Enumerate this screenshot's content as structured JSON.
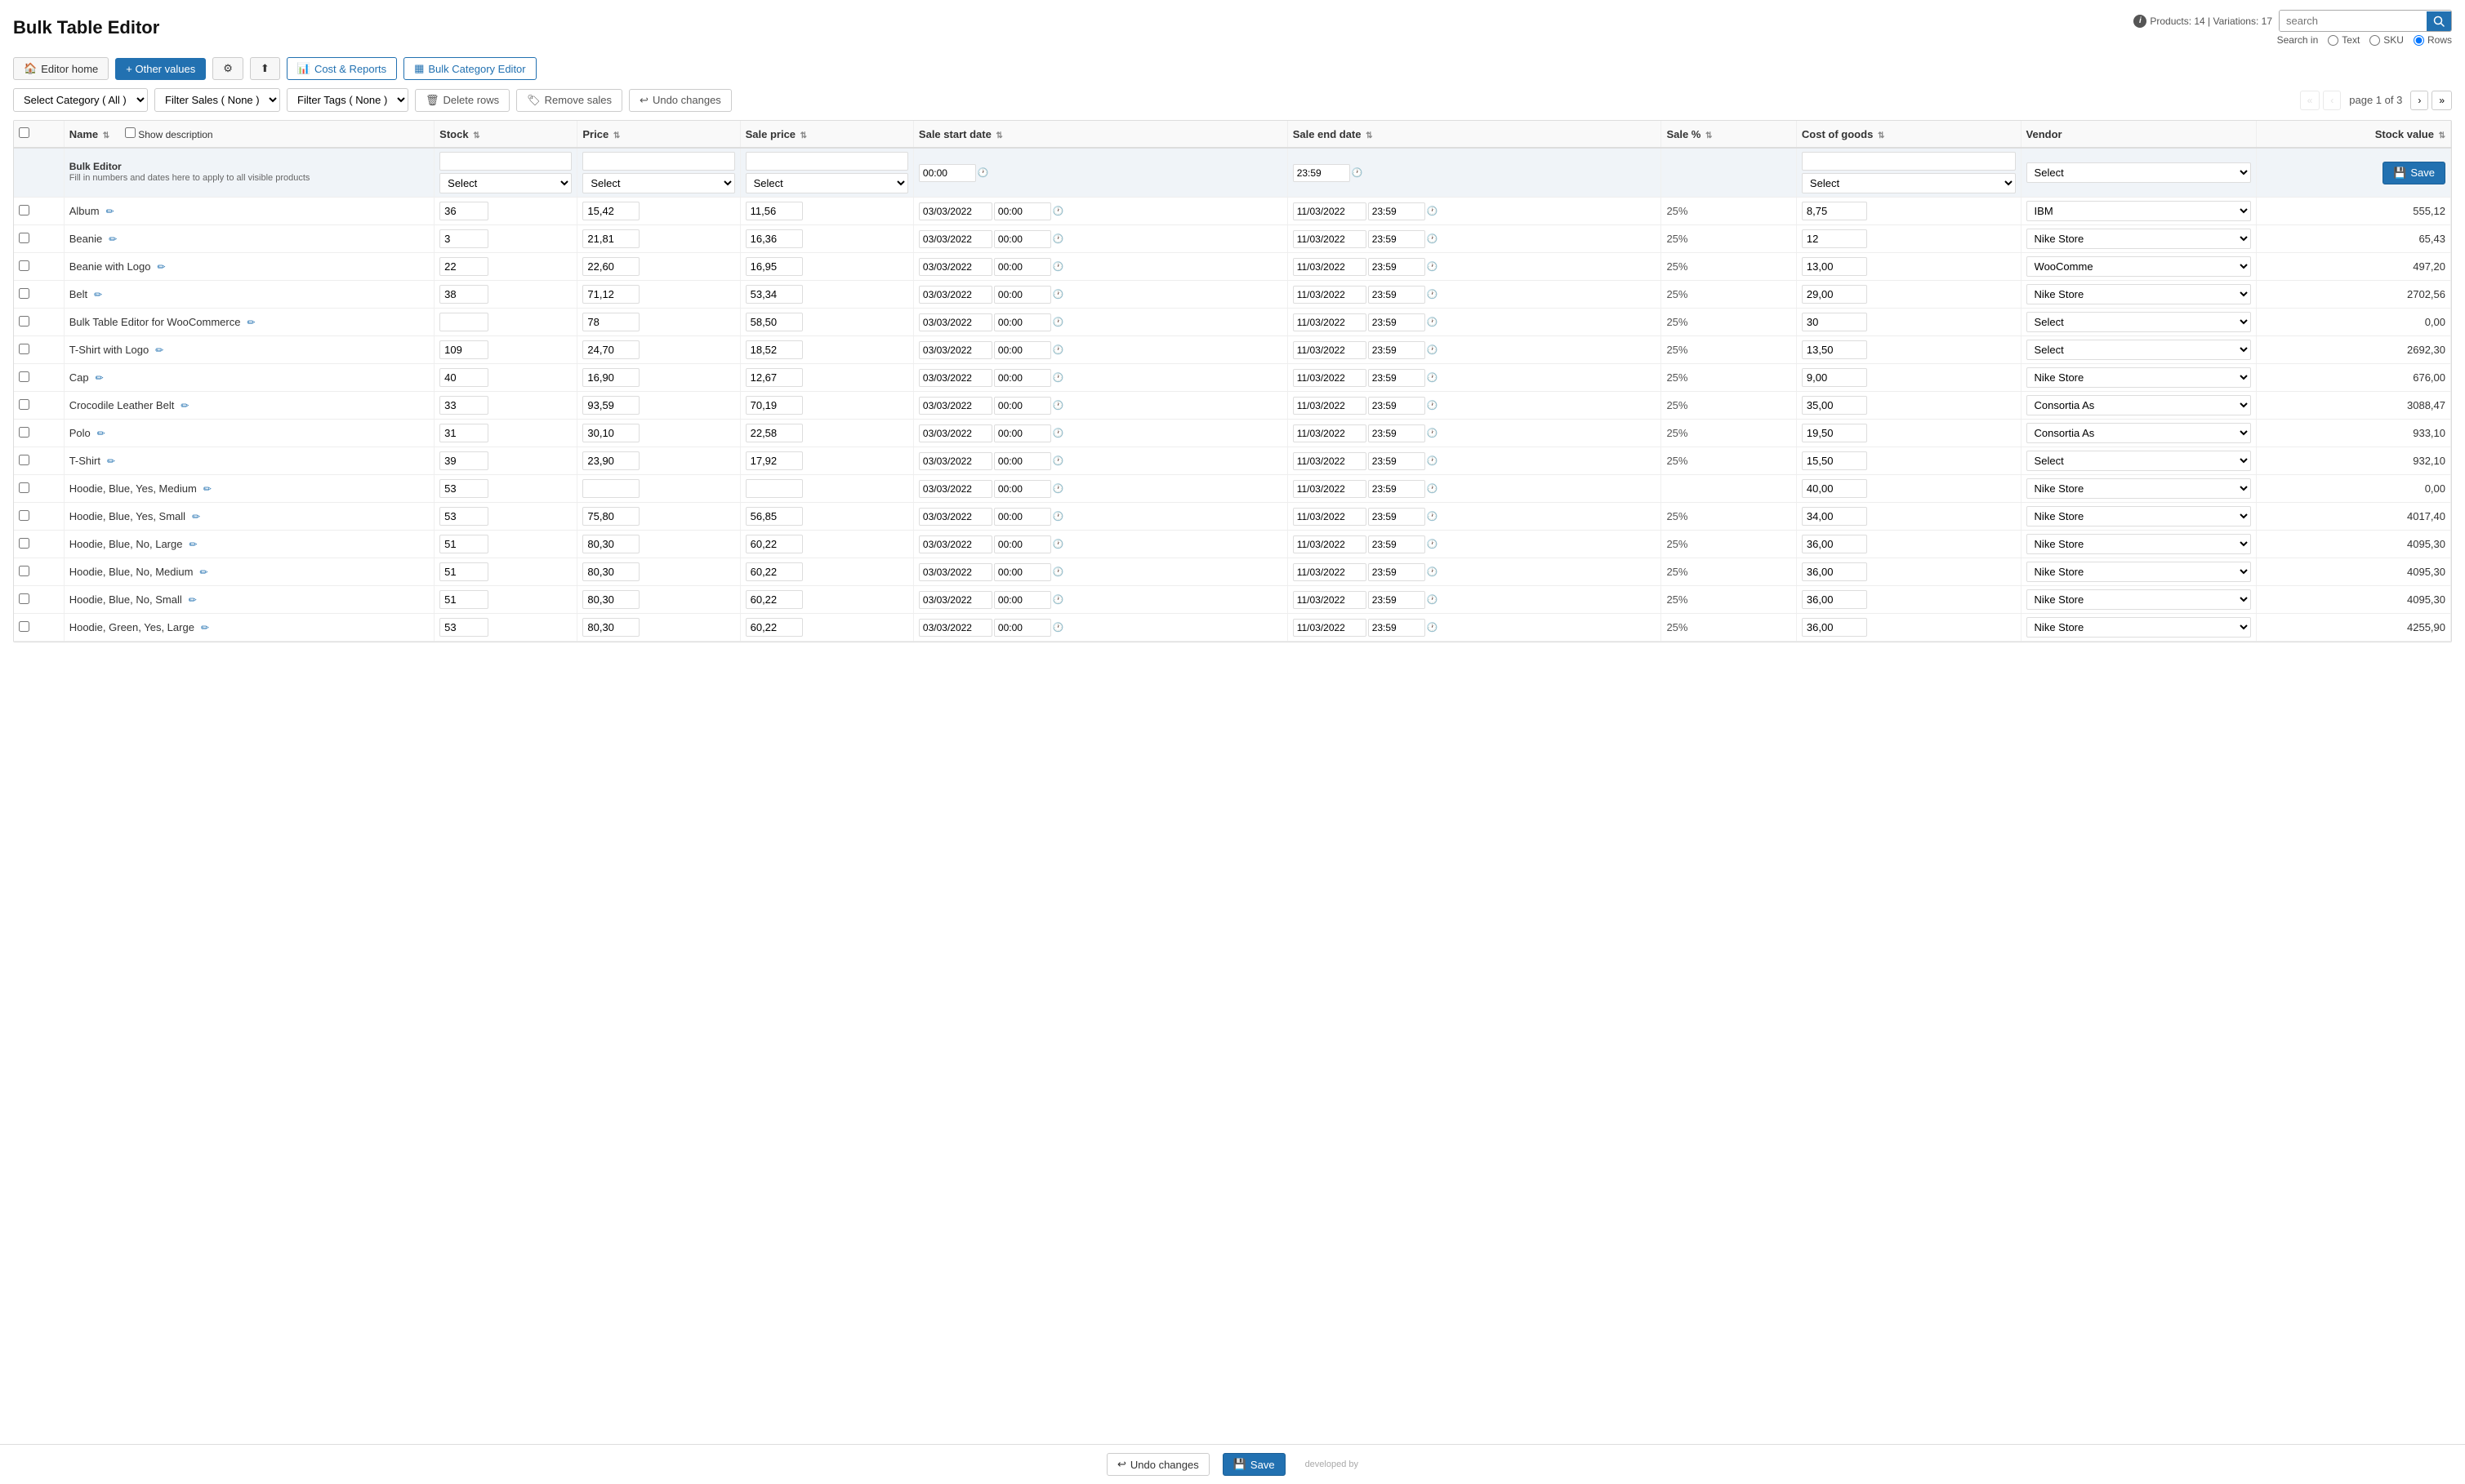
{
  "header": {
    "title": "Bulk Table Editor",
    "products_info": "Products: 14 | Variations: 17",
    "search_placeholder": "search",
    "search_label": "Search in",
    "radio_text": "Text",
    "radio_sku": "SKU",
    "radio_rows": "Rows"
  },
  "toolbar": {
    "editor_home": "Editor home",
    "other_values": "+ Other values",
    "settings": "⚙",
    "import": "↑",
    "cost_reports": "Cost & Reports",
    "bulk_category": "Bulk Category Editor"
  },
  "filters": {
    "category_label": "Select Category ( All )",
    "sales_label": "Filter Sales ( None )",
    "tags_label": "Filter Tags ( None )",
    "delete_rows": "Delete rows",
    "remove_sales": "Remove sales",
    "undo_changes": "Undo changes"
  },
  "pagination": {
    "page_info": "page 1 of 3",
    "first": "«",
    "prev": "‹",
    "next": "›",
    "last": "»"
  },
  "table": {
    "columns": [
      "Name",
      "Show description",
      "Stock",
      "Price",
      "Sale price",
      "Sale start date",
      "Sale end date",
      "Sale %",
      "Cost of goods",
      "Vendor",
      "Stock value"
    ],
    "bulk_editor": {
      "label": "Bulk Editor",
      "description": "Fill in numbers and dates here to apply to all visible products",
      "stock_select": "Select",
      "price_select": "Select",
      "sale_price_select": "Select",
      "sale_start_time": "00:00",
      "sale_end_time": "23:59",
      "cost_select": "Select",
      "vendor_select": "Select",
      "save_label": "Save"
    },
    "rows": [
      {
        "name": "Album",
        "stock": "36",
        "price": "15,42",
        "sale_price": "11,56",
        "sale_start": "03/03/2022",
        "sale_start_time": "00:00",
        "sale_end": "11/03/2022",
        "sale_end_time": "23:59",
        "sale_pct": "25%",
        "cost": "8,75",
        "vendor": "IBM",
        "stock_value": "555,12"
      },
      {
        "name": "Beanie",
        "stock": "3",
        "price": "21,81",
        "sale_price": "16,36",
        "sale_start": "03/03/2022",
        "sale_start_time": "00:00",
        "sale_end": "11/03/2022",
        "sale_end_time": "23:59",
        "sale_pct": "25%",
        "cost": "12",
        "vendor": "Nike Store",
        "stock_value": "65,43"
      },
      {
        "name": "Beanie with Logo",
        "stock": "22",
        "price": "22,60",
        "sale_price": "16,95",
        "sale_start": "03/03/2022",
        "sale_start_time": "00:00",
        "sale_end": "11/03/2022",
        "sale_end_time": "23:59",
        "sale_pct": "25%",
        "cost": "13,00",
        "vendor": "WooComme",
        "stock_value": "497,20"
      },
      {
        "name": "Belt",
        "stock": "38",
        "price": "71,12",
        "sale_price": "53,34",
        "sale_start": "03/03/2022",
        "sale_start_time": "00:00",
        "sale_end": "11/03/2022",
        "sale_end_time": "23:59",
        "sale_pct": "25%",
        "cost": "29,00",
        "vendor": "Nike Store",
        "stock_value": "2702,56"
      },
      {
        "name": "Bulk Table Editor for WooCommerce",
        "stock": "",
        "price": "78",
        "sale_price": "58,50",
        "sale_start": "03/03/2022",
        "sale_start_time": "00:00",
        "sale_end": "11/03/2022",
        "sale_end_time": "23:59",
        "sale_pct": "25%",
        "cost": "30",
        "vendor": "Select",
        "stock_value": "0,00"
      },
      {
        "name": "T-Shirt with Logo",
        "stock": "109",
        "price": "24,70",
        "sale_price": "18,52",
        "sale_start": "03/03/2022",
        "sale_start_time": "00:00",
        "sale_end": "11/03/2022",
        "sale_end_time": "23:59",
        "sale_pct": "25%",
        "cost": "13,50",
        "vendor": "Select",
        "stock_value": "2692,30"
      },
      {
        "name": "Cap",
        "stock": "40",
        "price": "16,90",
        "sale_price": "12,67",
        "sale_start": "03/03/2022",
        "sale_start_time": "00:00",
        "sale_end": "11/03/2022",
        "sale_end_time": "23:59",
        "sale_pct": "25%",
        "cost": "9,00",
        "vendor": "Nike Store",
        "stock_value": "676,00"
      },
      {
        "name": "Crocodile Leather Belt",
        "stock": "33",
        "price": "93,59",
        "sale_price": "70,19",
        "sale_start": "03/03/2022",
        "sale_start_time": "00:00",
        "sale_end": "11/03/2022",
        "sale_end_time": "23:59",
        "sale_pct": "25%",
        "cost": "35,00",
        "vendor": "Consortia As",
        "stock_value": "3088,47"
      },
      {
        "name": "Polo",
        "stock": "31",
        "price": "30,10",
        "sale_price": "22,58",
        "sale_start": "03/03/2022",
        "sale_start_time": "00:00",
        "sale_end": "11/03/2022",
        "sale_end_time": "23:59",
        "sale_pct": "25%",
        "cost": "19,50",
        "vendor": "Consortia As",
        "stock_value": "933,10"
      },
      {
        "name": "T-Shirt",
        "stock": "39",
        "price": "23,90",
        "sale_price": "17,92",
        "sale_start": "03/03/2022",
        "sale_start_time": "00:00",
        "sale_end": "11/03/2022",
        "sale_end_time": "23:59",
        "sale_pct": "25%",
        "cost": "15,50",
        "vendor": "Select",
        "stock_value": "932,10"
      },
      {
        "name": "Hoodie, Blue, Yes, Medium",
        "stock": "53",
        "price": "",
        "sale_price": "",
        "sale_start": "03/03/2022",
        "sale_start_time": "00:00",
        "sale_end": "11/03/2022",
        "sale_end_time": "23:59",
        "sale_pct": "",
        "cost": "40,00",
        "vendor": "Nike Store",
        "stock_value": "0,00"
      },
      {
        "name": "Hoodie, Blue, Yes, Small",
        "stock": "53",
        "price": "75,80",
        "sale_price": "56,85",
        "sale_start": "03/03/2022",
        "sale_start_time": "00:00",
        "sale_end": "11/03/2022",
        "sale_end_time": "23:59",
        "sale_pct": "25%",
        "cost": "34,00",
        "vendor": "Nike Store",
        "stock_value": "4017,40"
      },
      {
        "name": "Hoodie, Blue, No, Large",
        "stock": "51",
        "price": "80,30",
        "sale_price": "60,22",
        "sale_start": "03/03/2022",
        "sale_start_time": "00:00",
        "sale_end": "11/03/2022",
        "sale_end_time": "23:59",
        "sale_pct": "25%",
        "cost": "36,00",
        "vendor": "Nike Store",
        "stock_value": "4095,30"
      },
      {
        "name": "Hoodie, Blue, No, Medium",
        "stock": "51",
        "price": "80,30",
        "sale_price": "60,22",
        "sale_start": "03/03/2022",
        "sale_start_time": "00:00",
        "sale_end": "11/03/2022",
        "sale_end_time": "23:59",
        "sale_pct": "25%",
        "cost": "36,00",
        "vendor": "Nike Store",
        "stock_value": "4095,30"
      },
      {
        "name": "Hoodie, Blue, No, Small",
        "stock": "51",
        "price": "80,30",
        "sale_price": "60,22",
        "sale_start": "03/03/2022",
        "sale_start_time": "00:00",
        "sale_end": "11/03/2022",
        "sale_end_time": "23:59",
        "sale_pct": "25%",
        "cost": "36,00",
        "vendor": "Nike Store",
        "stock_value": "4095,30"
      },
      {
        "name": "Hoodie, Green, Yes, Large",
        "stock": "53",
        "price": "80,30",
        "sale_price": "60,22",
        "sale_start": "03/03/2022",
        "sale_start_time": "00:00",
        "sale_end": "11/03/2022",
        "sale_end_time": "23:59",
        "sale_pct": "25%",
        "cost": "36,00",
        "vendor": "Nike Store",
        "stock_value": "4255,90"
      }
    ]
  },
  "bottom_bar": {
    "undo_label": "Undo changes",
    "save_label": "Save"
  },
  "developed_by": "developed by"
}
